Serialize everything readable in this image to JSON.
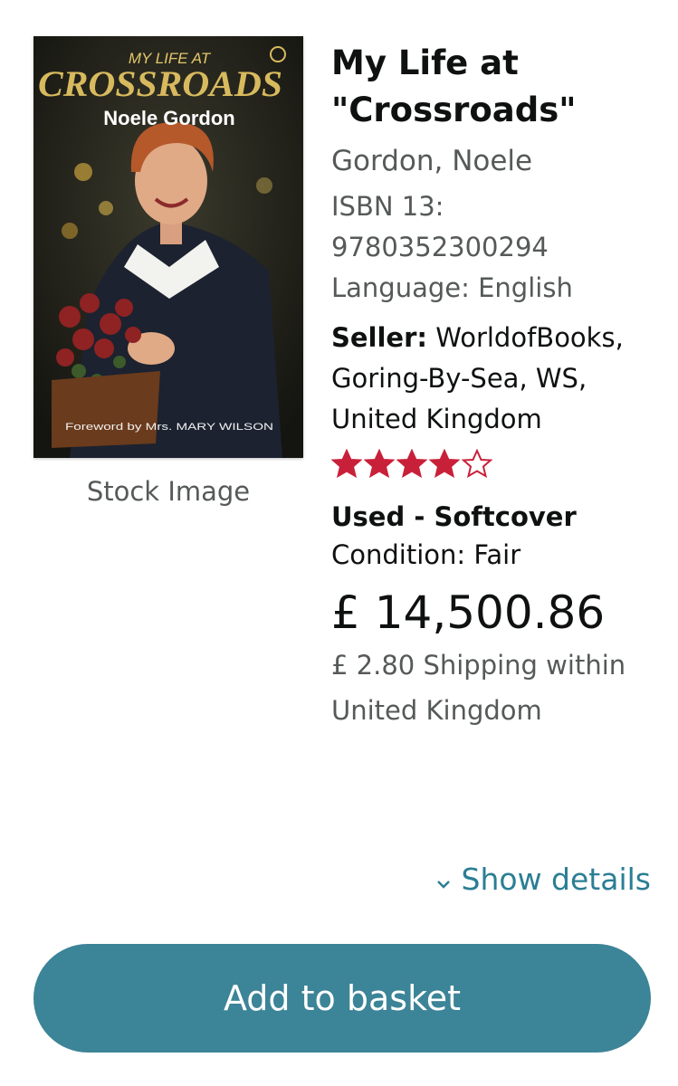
{
  "product": {
    "cover_image": {
      "alt": "Book cover",
      "cover_text": {
        "top": "MY LIFE AT",
        "main": "CROSSROADS",
        "author": "Noele Gordon",
        "footer": "Foreword by Mrs. MARY WILSON"
      }
    },
    "stock_label": "Stock Image",
    "title": "My Life at \"Crossroads\"",
    "author": "Gordon, Noele",
    "isbn_label": "ISBN 13:",
    "isbn_value": "9780352300294",
    "language": "Language: English",
    "seller_label": "Seller:",
    "seller_value": "WorldofBooks, Goring-By-Sea, WS, United Kingdom",
    "rating": 4,
    "rating_max": 5,
    "binding": "Used - Softcover",
    "condition": "Condition: Fair",
    "price": "£ 14,500.86",
    "shipping": "£ 2.80 Shipping within United Kingdom"
  },
  "actions": {
    "show_details": "Show details",
    "add_to_basket": "Add to basket"
  },
  "colors": {
    "star": "#c9203a",
    "link": "#2b7e94",
    "button": "#3c8497"
  },
  "icons": {
    "chevron": "chevron-down-icon",
    "star_full": "star-icon",
    "star_empty": "star-outline-icon"
  }
}
